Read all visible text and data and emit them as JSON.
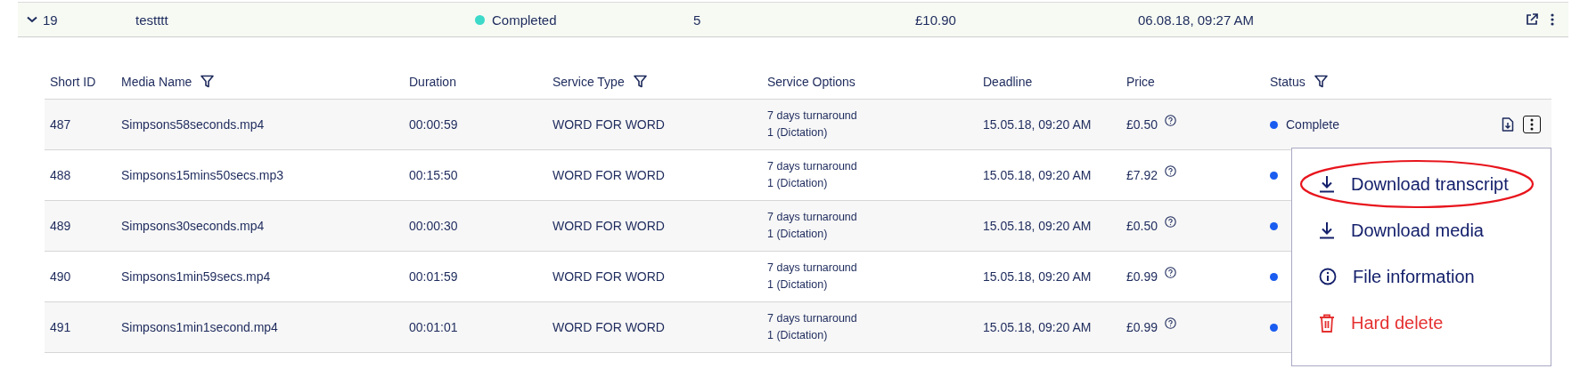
{
  "order": {
    "expanded": true,
    "id": "19",
    "name": "testttt",
    "status": "Completed",
    "color": "#3dd9c9",
    "files": "5",
    "total": "£10.90",
    "date": "06.08.18, 09:27 AM"
  },
  "table": {
    "columns": [
      {
        "label": "Short ID",
        "kind": "plain"
      },
      {
        "label": "Media Name",
        "kind": "filter"
      },
      {
        "label": "Duration",
        "kind": "plain"
      },
      {
        "label": "Service Type",
        "kind": "filter"
      },
      {
        "label": "Service Options",
        "kind": "plain"
      },
      {
        "label": "Deadline",
        "kind": "plain"
      },
      {
        "label": "Price",
        "kind": "plain"
      },
      {
        "label": "Status",
        "kind": "filter"
      }
    ],
    "rows": [
      {
        "id": "487",
        "media": "Simpsons58seconds.mp4",
        "duration": "00:00:59",
        "service": "WORD FOR WORD",
        "options": [
          "7 days turnaround",
          "1 (Dictation)"
        ],
        "deadline": "15.05.18, 09:20 AM",
        "price": "£0.50",
        "status": "Complete",
        "color": "#1a5cf0",
        "actions": {
          "focused": true
        }
      },
      {
        "id": "488",
        "media": "Simpsons15mins50secs.mp3",
        "duration": "00:15:50",
        "service": "WORD FOR WORD",
        "options": [
          "7 days turnaround",
          "1 (Dictation)"
        ],
        "deadline": "15.05.18, 09:20 AM",
        "price": "£7.92",
        "color": "#1a5cf0"
      },
      {
        "id": "489",
        "media": "Simpsons30seconds.mp4",
        "duration": "00:00:30",
        "service": "WORD FOR WORD",
        "options": [
          "7 days turnaround",
          "1 (Dictation)"
        ],
        "deadline": "15.05.18, 09:20 AM",
        "price": "£0.50",
        "color": "#1a5cf0"
      },
      {
        "id": "490",
        "media": "Simpsons1min59secs.mp4",
        "duration": "00:01:59",
        "service": "WORD FOR WORD",
        "options": [
          "7 days turnaround",
          "1 (Dictation)"
        ],
        "deadline": "15.05.18, 09:20 AM",
        "price": "£0.99",
        "color": "#1a5cf0"
      },
      {
        "id": "491",
        "media": "Simpsons1min1second.mp4",
        "duration": "00:01:01",
        "service": "WORD FOR WORD",
        "options": [
          "7 days turnaround",
          "1 (Dictation)"
        ],
        "deadline": "15.05.18, 09:20 AM",
        "price": "£0.99",
        "color": "#1a5cf0"
      }
    ]
  },
  "menu": {
    "items": [
      {
        "label": "Download transcript",
        "kind": "download",
        "circled": true
      },
      {
        "label": "Download media",
        "kind": "download",
        "circled": false
      },
      {
        "label": "File information",
        "kind": "info",
        "circled": false
      },
      {
        "label": "Hard delete",
        "kind": "delete",
        "circled": false
      }
    ]
  }
}
